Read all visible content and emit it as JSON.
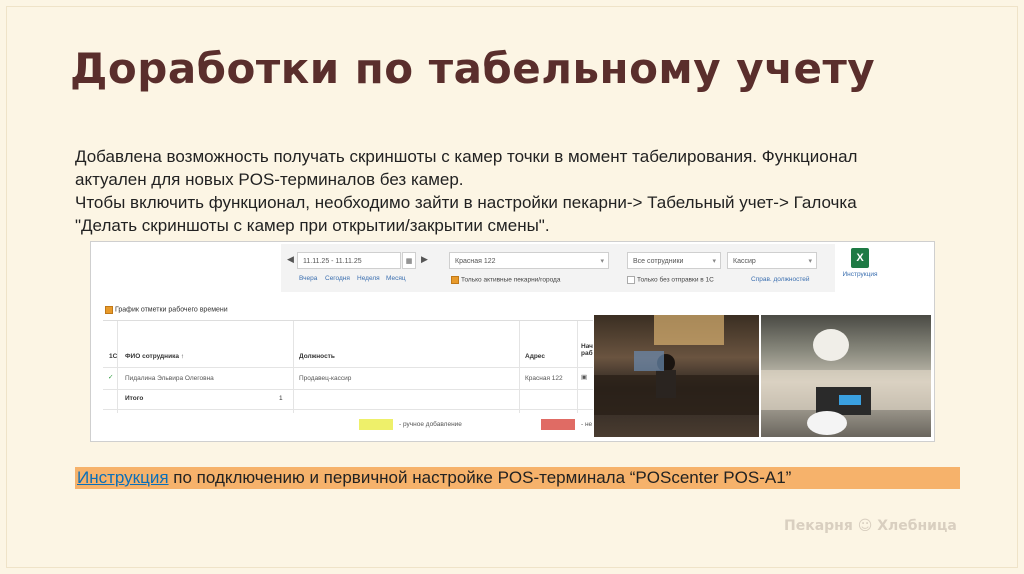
{
  "slide": {
    "title": "Доработки по табельному учету",
    "paragraph_lines": [
      "Добавлена возможность получать скриншоты с камер точки в момент табелирования. Функционал",
      "актуален для новых POS-терминалов без камер.",
      "Чтобы включить функционал, необходимо зайти в настройки пекарни-> Табельный учет-> Галочка",
      "\"Делать скриншоты с камер при открытии/закрытии смены\"."
    ],
    "instruction_link": "Инструкция",
    "instruction_rest": " по подключению и первичной настройке POS-терминала “POScenter POS-A1”",
    "brand": "Пекарня ☺ Хлебница"
  },
  "screenshot": {
    "date_range": "11.11.25 - 11.11.25",
    "quick_links": [
      "Вчера",
      "Сегодня",
      "Неделя",
      "Месяц"
    ],
    "store_select": "Красная 122",
    "only_active_label": "Только активные пекарни/города",
    "employees_select": "Все сотрудники",
    "role_select": "Кассир",
    "no_send_label": "Только без отправки в 1С",
    "positions_link": "Справ. должностей",
    "excel_label": "Инструкция",
    "grid_checkbox_label": "График отметки рабочего времени",
    "columns": [
      "1С",
      "ФИО сотрудника ↑",
      "Должность",
      "Адрес",
      "Нача раб"
    ],
    "row": {
      "name": "Пидалина Эльвира Олеговна",
      "position": "Продавец-кассир",
      "address": "Красная 122"
    },
    "total_label": "Итого",
    "total_count": "1",
    "legend_manual": "- ручное добавление",
    "legend_other": "- не"
  },
  "colors": {
    "title": "#5a2e2c",
    "background": "#fcf5e4",
    "highlight": "#f6b26b",
    "link": "#0b6fb8"
  }
}
